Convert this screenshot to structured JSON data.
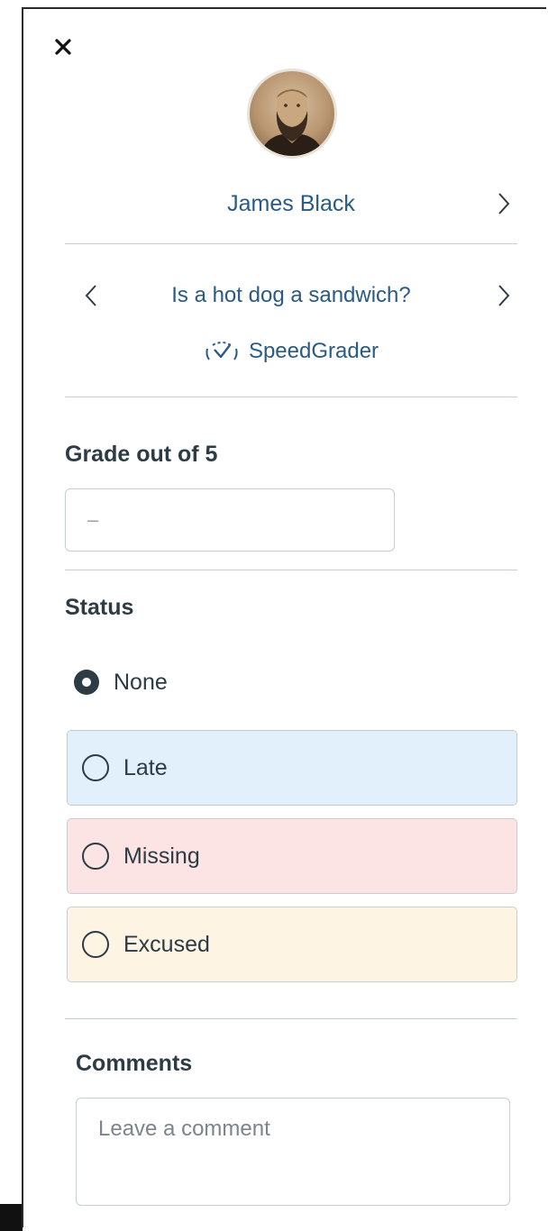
{
  "student": {
    "name": "James Black"
  },
  "assignment": {
    "title": "Is a hot dog a sandwich?"
  },
  "speedgrader": {
    "label": "SpeedGrader"
  },
  "grade": {
    "heading": "Grade out of 5",
    "placeholder": "–",
    "value": ""
  },
  "status": {
    "heading": "Status",
    "options": [
      {
        "label": "None",
        "selected": true
      },
      {
        "label": "Late",
        "selected": false,
        "color": "#e2f0fb"
      },
      {
        "label": "Missing",
        "selected": false,
        "color": "#fbe4e3"
      },
      {
        "label": "Excused",
        "selected": false,
        "color": "#fdf4e3"
      }
    ]
  },
  "comments": {
    "heading": "Comments",
    "placeholder": "Leave a comment"
  },
  "colors": {
    "link": "#2a5a86",
    "text": "#2d3b45",
    "divider": "#c7cdd1"
  },
  "icons": {
    "close": "close-icon",
    "next_student": "chevron-right-icon",
    "prev_assignment": "chevron-left-icon",
    "next_assignment": "chevron-right-icon",
    "speedgrader": "speedgrader-icon"
  }
}
